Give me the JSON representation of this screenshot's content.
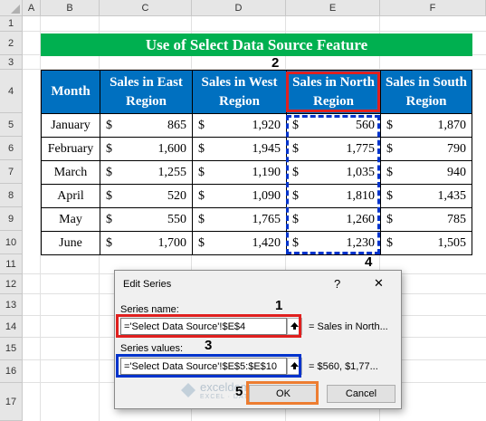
{
  "sheet": {
    "columns": [
      "A",
      "B",
      "C",
      "D",
      "E",
      "F"
    ],
    "rows": [
      "1",
      "2",
      "3",
      "4",
      "5",
      "6",
      "7",
      "8",
      "9",
      "10",
      "11",
      "12",
      "13",
      "14",
      "15",
      "16",
      "17"
    ]
  },
  "title": "Use of Select Data Source Feature",
  "table": {
    "headers": [
      "Month",
      "Sales in East Region",
      "Sales in West Region",
      "Sales in North Region",
      "Sales in South Region"
    ],
    "currency": "$",
    "rows": [
      {
        "month": "January",
        "east": "865",
        "west": "1,920",
        "north": "560",
        "south": "1,870"
      },
      {
        "month": "February",
        "east": "1,600",
        "west": "1,945",
        "north": "1,775",
        "south": "790"
      },
      {
        "month": "March",
        "east": "1,255",
        "west": "1,190",
        "north": "1,035",
        "south": "940"
      },
      {
        "month": "April",
        "east": "520",
        "west": "1,090",
        "north": "1,810",
        "south": "1,435"
      },
      {
        "month": "May",
        "east": "550",
        "west": "1,765",
        "north": "1,260",
        "south": "785"
      },
      {
        "month": "June",
        "east": "1,700",
        "west": "1,420",
        "north": "1,230",
        "south": "1,505"
      }
    ]
  },
  "markers": [
    "1",
    "2",
    "3",
    "4",
    "5"
  ],
  "colors": {
    "title_bg": "#00b050",
    "header_bg": "#0070c0",
    "highlight_red": "#e0201f",
    "highlight_blue": "#0033cc",
    "highlight_orange": "#ed7d31"
  },
  "dialog": {
    "title": "Edit Series",
    "help": "?",
    "close": "✕",
    "series_name_label": "Series name:",
    "series_name_value": "='Select Data Source'!$E$4",
    "series_name_preview": "= Sales in North...",
    "series_values_label": "Series values:",
    "series_values_value": "='Select Data Source'!$E$5:$E$10",
    "series_values_preview": "= $560, $1,77...",
    "ok_label": "OK",
    "cancel_label": "Cancel"
  },
  "watermark": "exceldemy EXCEL · DATA · BI"
}
